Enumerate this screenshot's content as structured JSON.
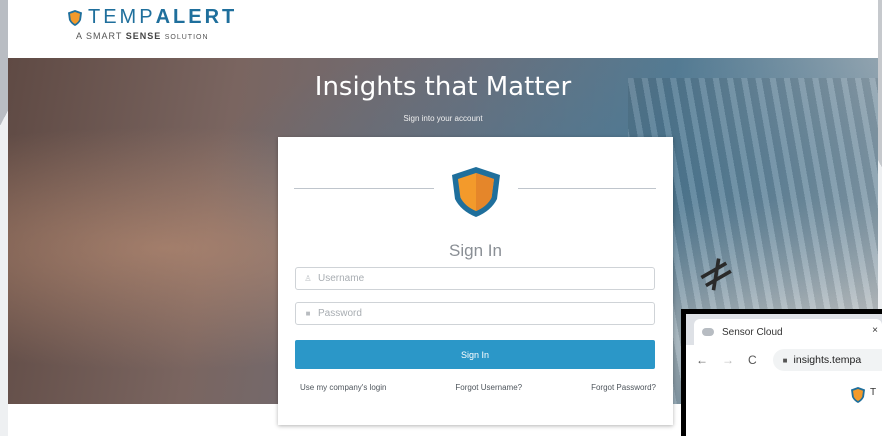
{
  "brand": {
    "name_part1": "TEMP",
    "name_part2": "ALERT",
    "tagline_prefix": "A SMART",
    "tagline_bold": "SENSE",
    "tagline_suffix": "SOLUTION",
    "primary_color": "#1f6f9c",
    "shield_color": "#f39a2b"
  },
  "hero": {
    "title": "Insights that Matter",
    "subtitle": "Sign into your account"
  },
  "login": {
    "title": "Sign In",
    "username_placeholder": "Username",
    "username_value": "",
    "password_placeholder": "Password",
    "password_value": "",
    "signin_button": "Sign In",
    "button_color": "#2b97c8",
    "links": {
      "company_login": "Use my company's login",
      "forgot_username": "Forgot Username?",
      "forgot_password": "Forgot Password?"
    }
  },
  "inset_browser": {
    "tab_title": "Sensor Cloud",
    "tab_close": "×",
    "url_text": "insights.tempa",
    "nav_icons": [
      "back-arrow-icon",
      "forward-arrow-icon",
      "reload-icon",
      "lock-icon"
    ],
    "page_partial_text": "T"
  }
}
